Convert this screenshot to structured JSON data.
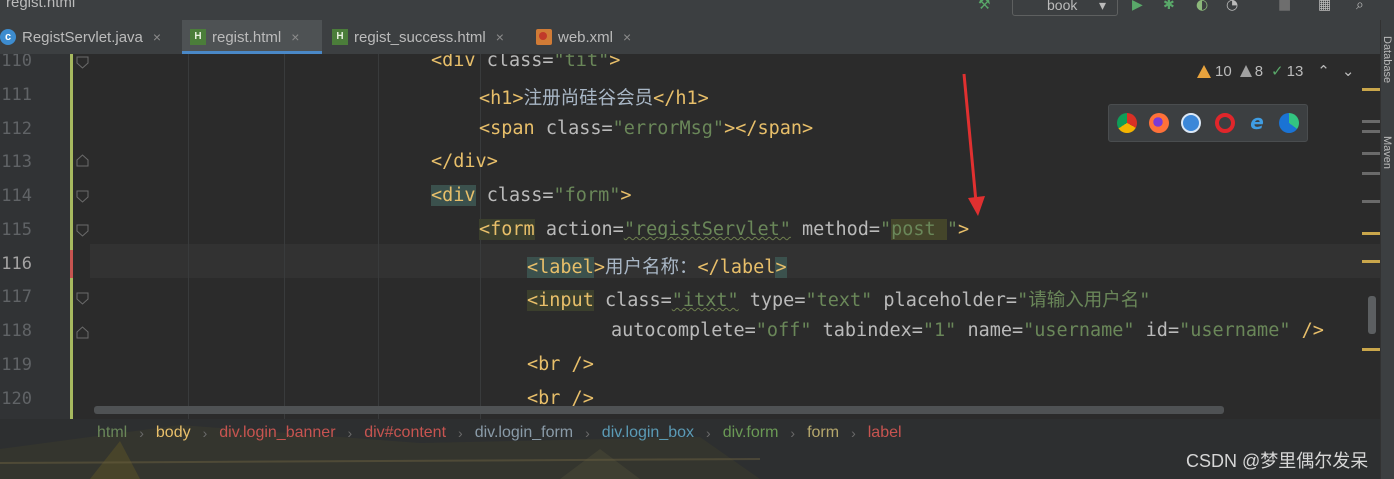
{
  "window": {
    "filename": "regist.html"
  },
  "toolbar": {
    "run_config": "book"
  },
  "tabs": [
    {
      "label": "RegistServlet.java",
      "icon": "java-class-icon",
      "close": "×",
      "active": false
    },
    {
      "label": "regist.html",
      "icon": "html-file-icon",
      "close": "×",
      "active": true
    },
    {
      "label": "regist_success.html",
      "icon": "html-file-icon",
      "close": "×",
      "active": false
    },
    {
      "label": "web.xml",
      "icon": "xml-file-icon",
      "close": "×",
      "active": false
    }
  ],
  "right_panel": {
    "database": "Database",
    "maven": "Maven"
  },
  "inspections": {
    "warnings": "10",
    "weak_warnings": "8",
    "typos": "13"
  },
  "line_numbers": [
    "110",
    "111",
    "112",
    "113",
    "114",
    "115",
    "116",
    "117",
    "118",
    "119",
    "120"
  ],
  "code": {
    "l110": [
      "<div",
      " class=",
      "\"tit\"",
      ">"
    ],
    "l111": [
      "<h1>",
      "注册尚硅谷会员",
      "</h1>"
    ],
    "l112": [
      "<span",
      " class=",
      "\"errorMsg\"",
      "></span>"
    ],
    "l113": [
      "</div>"
    ],
    "l114": [
      "<div",
      " class=",
      "\"form\"",
      ">"
    ],
    "l115": [
      "<form",
      " action=",
      "\"registServlet\"",
      " method=",
      "\"",
      "post ",
      "\"",
      ">"
    ],
    "l116": [
      "<label",
      ">",
      "用户名称：",
      "</label",
      ">"
    ],
    "l117": [
      "<input",
      " class=",
      "\"itxt\"",
      " type=",
      "\"text\"",
      " placeholder=",
      "\"请输入用户名\""
    ],
    "l118": [
      "autocomplete=",
      "\"off\"",
      " tabindex=",
      "\"1\"",
      " name=",
      "\"username\"",
      " id=",
      "\"username\"",
      " />"
    ],
    "l119": [
      "<br />"
    ],
    "l120": [
      "<br />"
    ]
  },
  "breadcrumb": [
    "html",
    "body",
    "div.login_banner",
    "div#content",
    "div.login_form",
    "div.login_box",
    "div.form",
    "form",
    "label"
  ],
  "breadcrumb_colors": [
    "#6a8759",
    "#e8bf6a",
    "#c75450",
    "#c75450",
    "#8a9ba8",
    "#5b9bb5",
    "#6a9955",
    "#b5a76c",
    "#c75450"
  ],
  "watermark": "CSDN @梦里偶尔发呆",
  "colors": {
    "accent": "#4a88c7",
    "tag": "#e8bf6a",
    "string": "#6a8759",
    "arrow": "#e03030"
  }
}
